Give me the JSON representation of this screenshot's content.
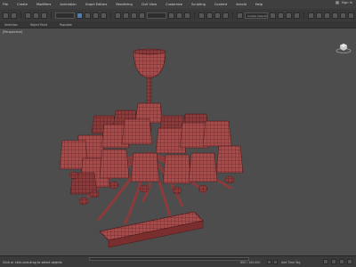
{
  "menubar": {
    "items": [
      "File",
      "Create",
      "Modifiers",
      "Animation",
      "Graph Editors",
      "Rendering",
      "Civil View",
      "Customize",
      "Scripting",
      "Content",
      "Arnold",
      "Help"
    ],
    "signin_label": "Sign In"
  },
  "toolbar": {
    "named_selection_placeholder": "Create Selection Se"
  },
  "ribbon": {
    "tabs": [
      "Selection",
      "Object Paint",
      "Populate"
    ]
  },
  "viewport": {
    "label": "[Perspective]"
  },
  "statusbar": {
    "prompt": "Click or click-and-drag to select objects",
    "coords": "600 / 100.000",
    "autokey_label": "Add Time Tag"
  },
  "colors": {
    "mesh_fill": "#a84b4b",
    "mesh_wire": "#4a1818",
    "viewport_bg": "#4d4d4d",
    "active_tool": "#4a7fb5"
  }
}
